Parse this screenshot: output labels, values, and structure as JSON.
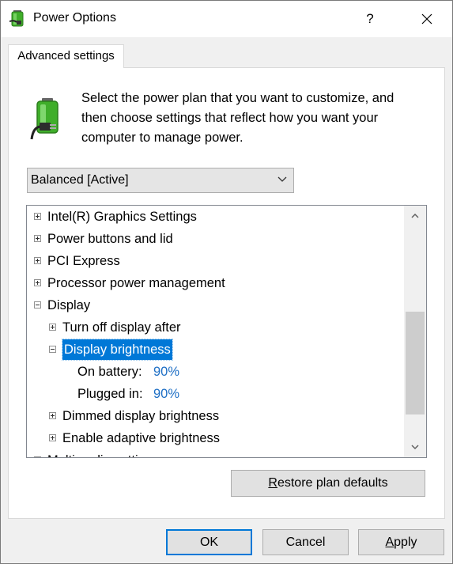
{
  "window": {
    "title": "Power Options",
    "help_glyph": "?",
    "close_icon": "close-icon",
    "app_icon": "power-options-icon"
  },
  "tabs": [
    {
      "label": "Advanced settings",
      "active": true
    }
  ],
  "description": {
    "line1": "Select the power plan that you want to customize, and",
    "line2": "then choose settings that reflect how you want your",
    "line3": "computer to manage power.",
    "icon": "battery-plug-icon"
  },
  "plan_select": {
    "value": "Balanced [Active]",
    "icon": "chevron-down-icon"
  },
  "tree": {
    "items": [
      {
        "label": "Intel(R) Graphics Settings",
        "expander": "plus"
      },
      {
        "label": "Power buttons and lid",
        "expander": "plus"
      },
      {
        "label": "PCI Express",
        "expander": "plus"
      },
      {
        "label": "Processor power management",
        "expander": "plus"
      },
      {
        "label": "Display",
        "expander": "minus"
      },
      {
        "label": "Turn off display after",
        "expander": "plus"
      },
      {
        "label": "Display brightness",
        "expander": "minus",
        "selected": true
      },
      {
        "label": "On battery:",
        "value": "90%"
      },
      {
        "label": "Plugged in:",
        "value": "90%"
      },
      {
        "label": "Dimmed display brightness",
        "expander": "plus"
      },
      {
        "label": "Enable adaptive brightness",
        "expander": "plus"
      },
      {
        "label": "Multimedia settings",
        "expander": "plus"
      }
    ],
    "scroll_position": 0.45
  },
  "buttons": {
    "restore": {
      "pre": "",
      "accel": "R",
      "post": "estore plan defaults"
    },
    "ok": "OK",
    "cancel": "Cancel",
    "apply": {
      "accel": "A",
      "post": "pply"
    }
  },
  "colors": {
    "accent": "#0078d7",
    "value_link": "#1e6fc5",
    "battery_green": "#3fae2a"
  }
}
